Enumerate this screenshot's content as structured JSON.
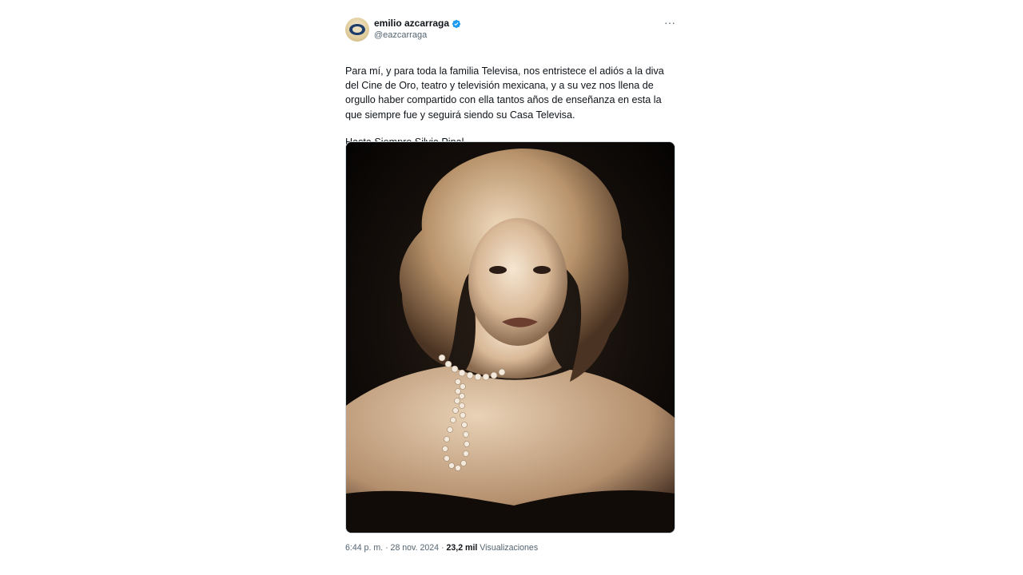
{
  "author": {
    "display_name": "emilio azcarraga",
    "handle": "@eazcarraga",
    "verified": true,
    "avatar_icon": "avatar-logo-icon"
  },
  "menu": {
    "more_label": "···"
  },
  "tweet": {
    "text": "Para mí, y para toda la familia Televisa, nos entristece el adiós a la diva del Cine de Oro, teatro y televisión mexicana, y a su vez nos llena de orgullo haber compartido con ella tantos años de enseñanza en esta la que siempre fue y seguirá siendo su Casa Televisa.",
    "sign_off": "Hasta Siempre Silvia Pinal"
  },
  "meta": {
    "time": "6:44 p. m.",
    "separator": "·",
    "date": "28 nov. 2024",
    "views_count": "23,2 mil",
    "views_label": "Visualizaciones"
  },
  "colors": {
    "text_primary": "#0f1419",
    "text_secondary": "#536471",
    "verified_blue": "#1d9bf0",
    "border": "#cfd9de"
  }
}
